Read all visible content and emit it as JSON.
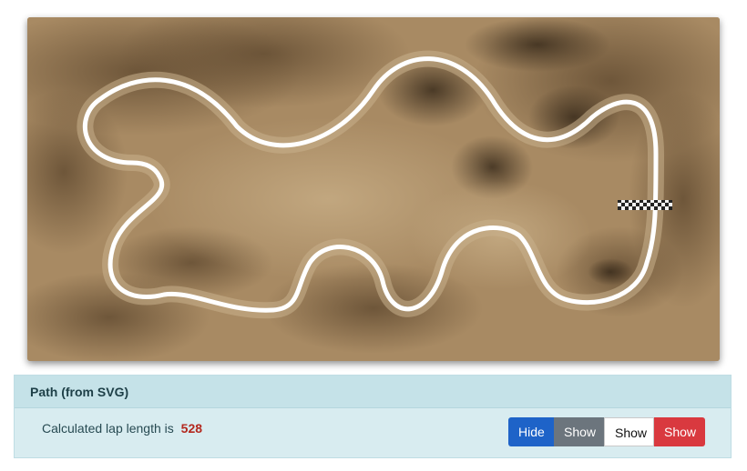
{
  "map": {
    "image_description_icon": "aerial-terrain-map",
    "track_color": "#ffffff",
    "finish_line_icon": "checkered-finish-line"
  },
  "panel": {
    "title": "Path (from SVG)",
    "lap_prefix": "Calculated lap length is",
    "lap_length": "528"
  },
  "buttons": {
    "hide": "Hide",
    "show_grey": "Show",
    "show_white": "Show",
    "show_red": "Show"
  },
  "colors": {
    "panel_bg": "#d8ecf0",
    "panel_header_bg": "#c5e2e8",
    "hide_button": "#1e63c8",
    "grey_button": "#6c757d",
    "red_button": "#d9393f",
    "lap_value": "#b3281e"
  }
}
